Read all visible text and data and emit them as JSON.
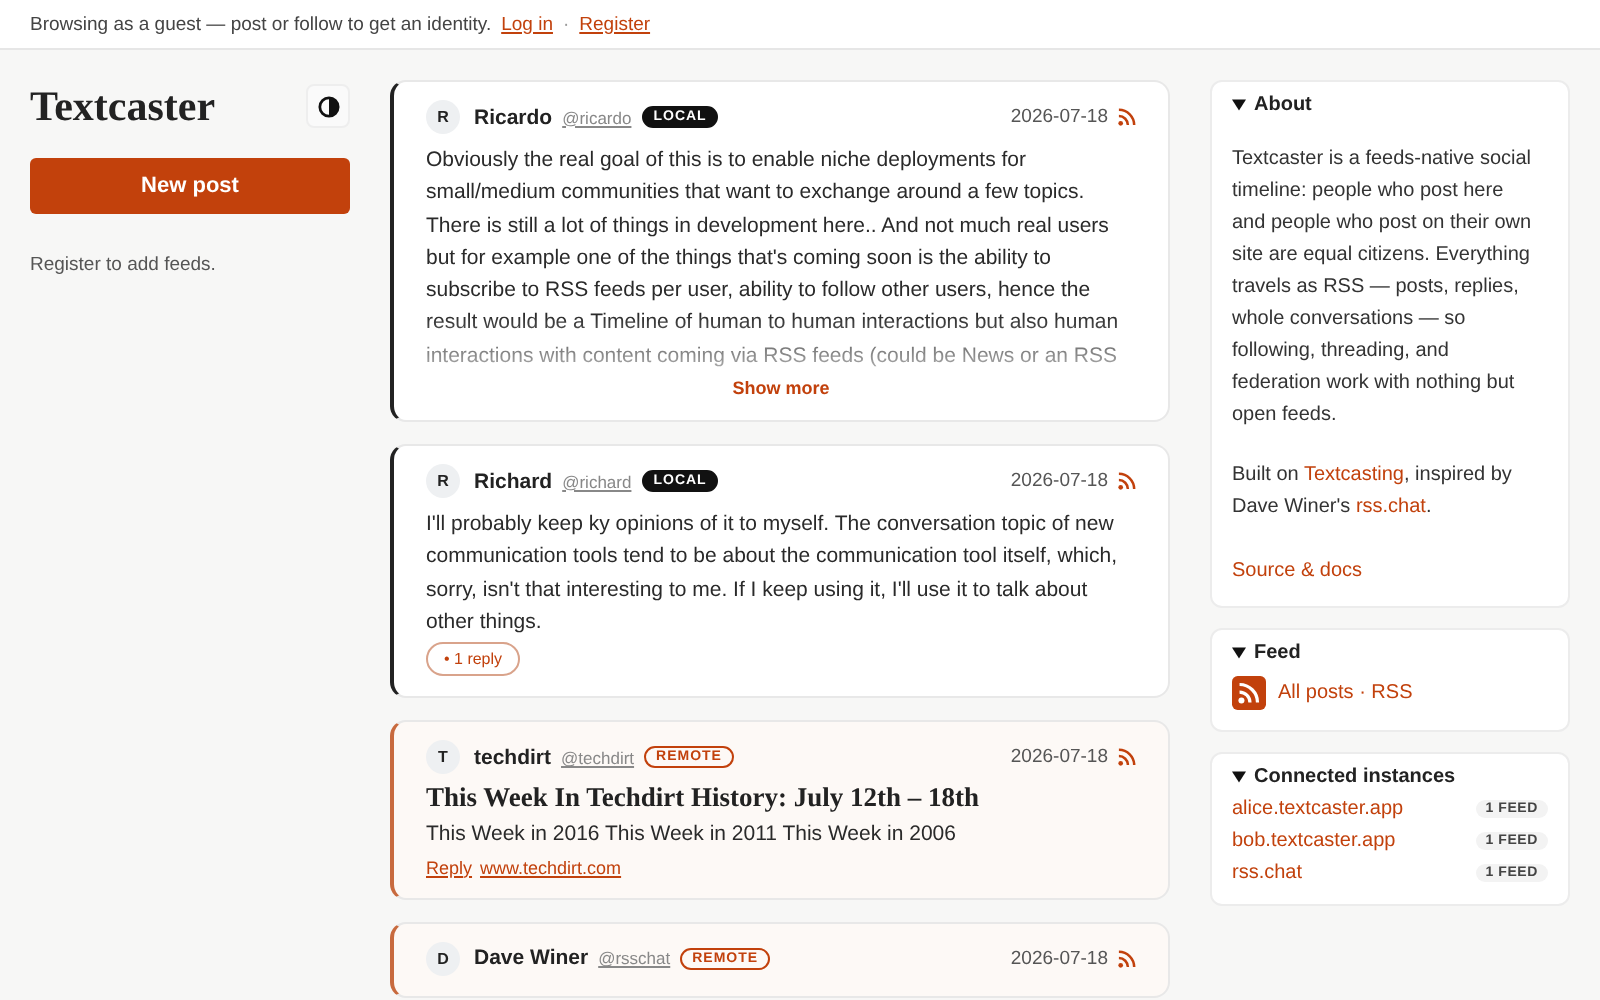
{
  "guest_bar": {
    "text": "Browsing as a guest — post or follow to get an identity.",
    "links": [
      "Log in",
      "Register"
    ],
    "separator": "·"
  },
  "sidebar": {
    "logo": "Textcaster",
    "new_post": "New post",
    "hint": "Register to add feeds."
  },
  "posts": [
    {
      "kind": "local",
      "initial": "R",
      "author": "Ricardo",
      "handle": "@ricardo",
      "badge": "LOCAL",
      "date": "2026-07-18",
      "body": "Obviously the real goal of this is to enable niche deployments for small/medium communities that want to exchange around a few topics. There is still a lot of things in development here.. And not much real users but for example one of the things that's coming soon is the ability to subscribe to RSS feeds per user, ability to follow other users, hence the result would be a Timeline of human to human interactions but also human interactions with content coming via RSS feeds (could be News or an RSS",
      "show_more": "Show more"
    },
    {
      "kind": "local",
      "initial": "R",
      "author": "Richard",
      "handle": "@richard",
      "badge": "LOCAL",
      "date": "2026-07-18",
      "body": "I'll probably keep ky opinions of it to myself. The conversation topic of new communication tools tend to be about the communication tool itself, which, sorry, isn't that interesting to me. If I keep using it, I'll use it to talk about other things.",
      "replies": "• 1 reply"
    },
    {
      "kind": "remote",
      "initial": "T",
      "author": "techdirt",
      "handle": "@techdirt",
      "badge": "REMOTE",
      "date": "2026-07-18",
      "title": "This Week In Techdirt History: July 12th – 18th",
      "body": "This Week in 2016 This Week in 2011 This Week in 2006",
      "links": [
        "Reply",
        "www.techdirt.com"
      ]
    },
    {
      "kind": "remote",
      "initial": "D",
      "author": "Dave Winer",
      "handle": "@rsschat",
      "badge": "REMOTE",
      "date": "2026-07-18"
    }
  ],
  "about": {
    "title": "About",
    "expanded": true,
    "text": "Textcaster is a feeds-native social timeline: people who post here and people who post on their own site are equal citizens. Everything travels as RSS — posts, replies, whole conversations — so following, threading, and federation work with nothing but open feeds.",
    "built_on": [
      "Built on ",
      "Textcasting",
      ", inspired by Dave Winer's ",
      "rss.chat",
      "."
    ],
    "source": "Source & docs"
  },
  "feed": {
    "title": "Feed",
    "expanded": true,
    "link": "All posts · RSS"
  },
  "instances": {
    "title": "Connected instances",
    "expanded": true,
    "items": [
      {
        "name": "alice.textcaster.app",
        "count": "1 FEED"
      },
      {
        "name": "bob.textcaster.app",
        "count": "1 FEED"
      },
      {
        "name": "rss.chat",
        "count": "1 FEED"
      }
    ]
  }
}
